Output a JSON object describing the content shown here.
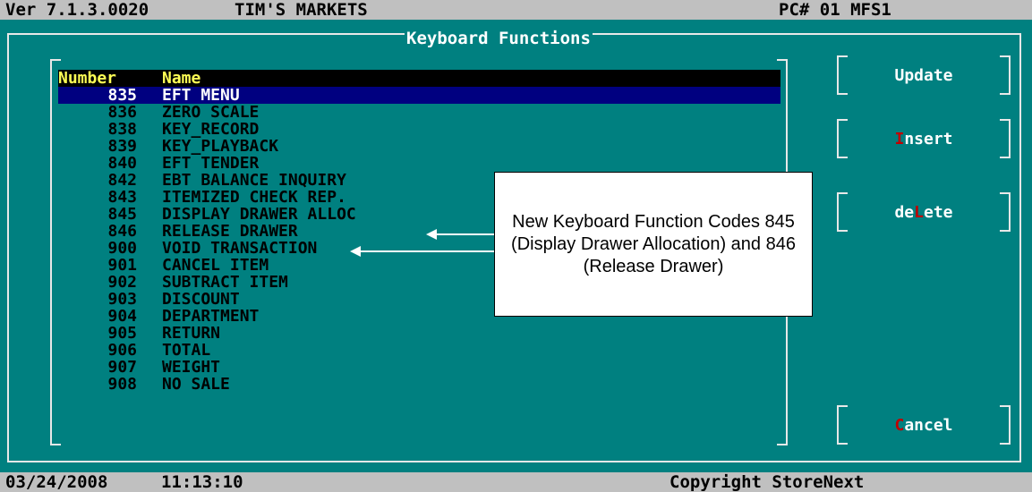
{
  "header": {
    "version": "Ver 7.1.3.0020",
    "store": "TIM'S MARKETS",
    "pc": "PC# 01 MFS1"
  },
  "window": {
    "title": "Keyboard Functions"
  },
  "list": {
    "columns": [
      "Number",
      "Name"
    ],
    "rows": [
      {
        "number": "835",
        "name": "EFT MENU"
      },
      {
        "number": "836",
        "name": "ZERO SCALE"
      },
      {
        "number": "838",
        "name": "KEY_RECORD"
      },
      {
        "number": "839",
        "name": "KEY_PLAYBACK"
      },
      {
        "number": "840",
        "name": "EFT TENDER"
      },
      {
        "number": "842",
        "name": "EBT BALANCE INQUIRY"
      },
      {
        "number": "843",
        "name": "ITEMIZED CHECK REP."
      },
      {
        "number": "845",
        "name": "DISPLAY DRAWER ALLOC"
      },
      {
        "number": "846",
        "name": "RELEASE DRAWER"
      },
      {
        "number": "900",
        "name": "VOID TRANSACTION"
      },
      {
        "number": "901",
        "name": "CANCEL ITEM"
      },
      {
        "number": "902",
        "name": "SUBTRACT ITEM"
      },
      {
        "number": "903",
        "name": "DISCOUNT"
      },
      {
        "number": "904",
        "name": "DEPARTMENT"
      },
      {
        "number": "905",
        "name": "RETURN"
      },
      {
        "number": "906",
        "name": "TOTAL"
      },
      {
        "number": "907",
        "name": "WEIGHT"
      },
      {
        "number": "908",
        "name": "NO SALE"
      }
    ],
    "selected_number": "835"
  },
  "buttons": {
    "update": {
      "label": "Update"
    },
    "insert": {
      "hotkey": "I",
      "rest": "nsert"
    },
    "delete": {
      "pre": "de",
      "hotkey": "L",
      "rest": "ete"
    },
    "cancel": {
      "hotkey": "C",
      "rest": "ancel"
    }
  },
  "callout": {
    "text": "New Keyboard Function Codes 845 (Display Drawer Allocation) and 846 (Release Drawer)"
  },
  "footer": {
    "date": "03/24/2008",
    "time": "11:13:10",
    "copyright": "Copyright StoreNext"
  },
  "colors": {
    "background": "#008080",
    "selected_row": "#000080",
    "header_text": "#ffff55",
    "hotkey": "#c00000"
  }
}
